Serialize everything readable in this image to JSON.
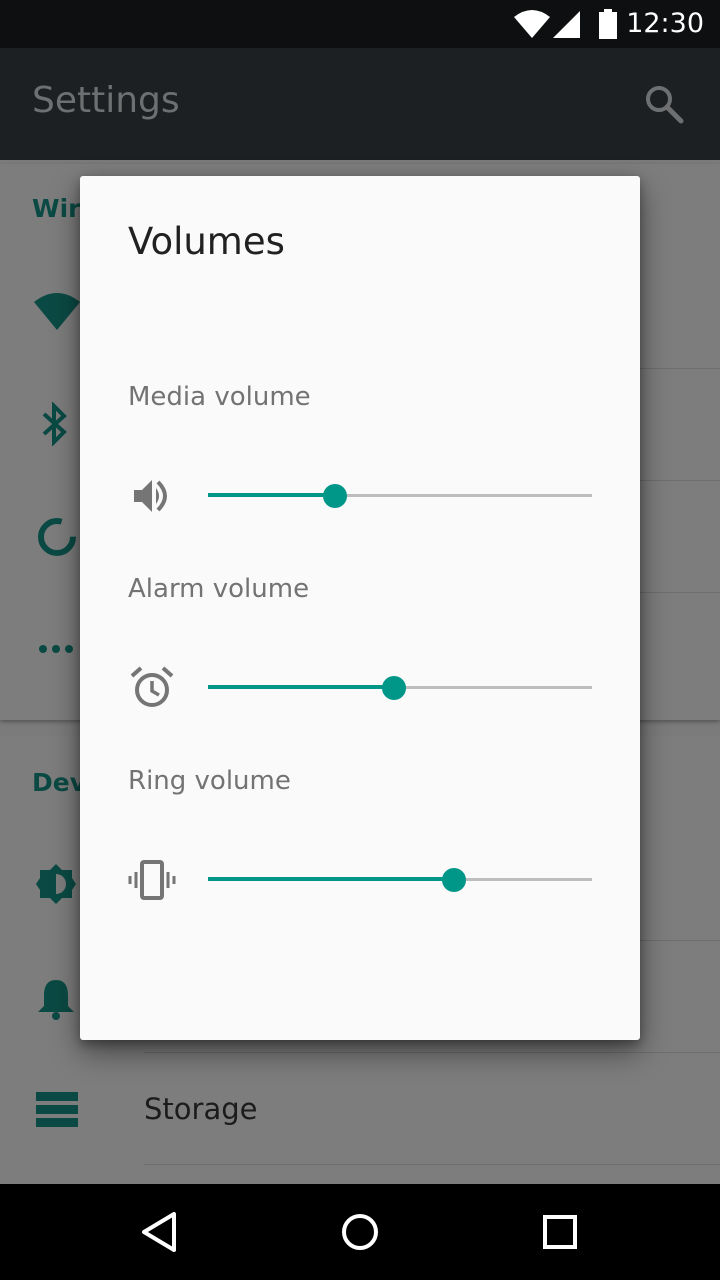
{
  "status_bar": {
    "time": "12:30",
    "icons": [
      "wifi-icon",
      "cellular-signal-icon",
      "battery-icon"
    ]
  },
  "app_bar": {
    "title": "Settings",
    "search_icon": "search-icon"
  },
  "background_list": {
    "sections": [
      {
        "label": "Wireless & networks",
        "visible_label": "Wire",
        "icons": [
          "wifi-icon",
          "bluetooth-icon",
          "data-usage-icon",
          "more-icon"
        ]
      },
      {
        "label": "Device",
        "visible_label": "Dev",
        "icons": [
          "brightness-icon",
          "notifications-bell-icon",
          "storage-icon"
        ]
      }
    ],
    "storage_label": "Storage"
  },
  "dialog": {
    "title": "Volumes",
    "sliders": [
      {
        "label": "Media volume",
        "icon": "speaker-icon",
        "level": 0.33
      },
      {
        "label": "Alarm volume",
        "icon": "alarm-clock-icon",
        "level": 0.485
      },
      {
        "label": "Ring volume",
        "icon": "vibrate-icon",
        "level": 0.64
      }
    ]
  },
  "colors": {
    "accent": "#009688",
    "track": "#bdbdbd",
    "dialog_bg": "#fafafa",
    "app_bar": "#1c2022"
  },
  "nav_bar": {
    "buttons": [
      "back-icon",
      "home-icon",
      "recents-icon"
    ]
  }
}
